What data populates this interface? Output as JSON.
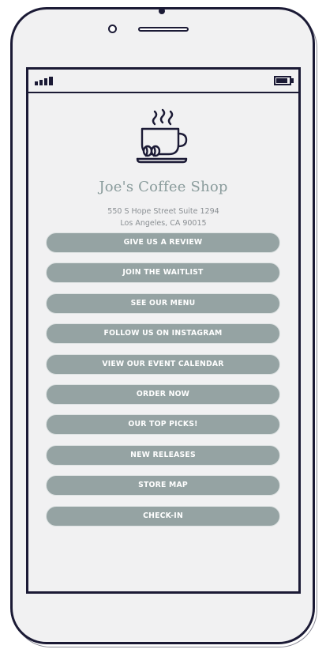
{
  "shop": {
    "name": "Joe's Coffee Shop",
    "address_line1": "550 S Hope Street Suite 1294",
    "address_line2": "Los Angeles, CA 90015"
  },
  "buttons": [
    "GIVE US A REVIEW",
    "JOIN THE WAITLIST",
    "SEE OUR MENU",
    "FOLLOW US ON INSTAGRAM",
    "VIEW OUR EVENT CALENDAR",
    "ORDER NOW",
    "OUR TOP PICKS!",
    "NEW RELEASES",
    "STORE MAP",
    "CHECK-IN"
  ],
  "colors": {
    "button": "#95a3a3",
    "title": "#8a9c9c",
    "outline": "#1b1a35"
  },
  "icons": {
    "logo": "coffee-cup-icon",
    "status_signal": "signal-icon",
    "status_battery": "battery-icon"
  }
}
